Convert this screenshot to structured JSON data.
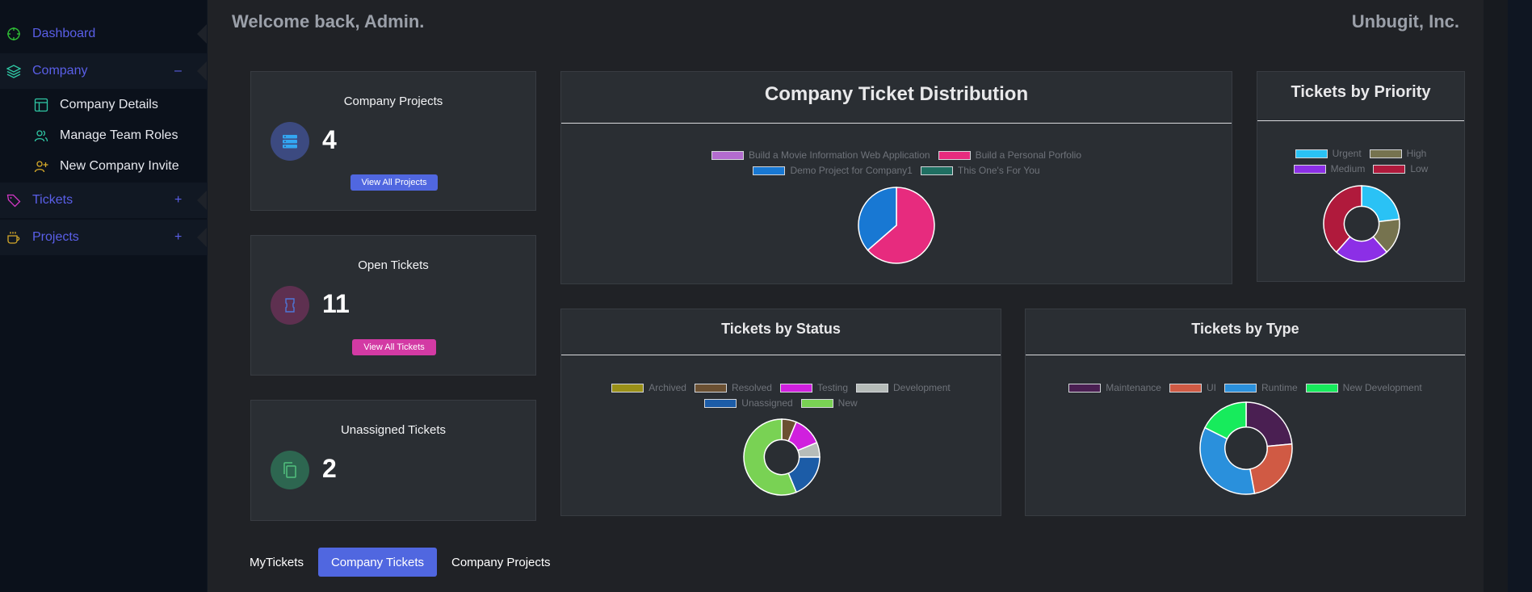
{
  "sidebar": {
    "items": [
      {
        "label": "Dashboard",
        "icon": "crosshair-icon",
        "color": "#5a5fe8",
        "icon_color": "#2fbe35"
      },
      {
        "label": "Company",
        "icon": "layers-icon",
        "color": "#5a5fe8",
        "icon_color": "#2fc7a4",
        "toggle": "–"
      },
      {
        "label": "Tickets",
        "icon": "tag-icon",
        "color": "#5a5fe8",
        "icon_color": "#d437c5",
        "toggle": "+"
      },
      {
        "label": "Projects",
        "icon": "coffee-icon",
        "color": "#5a5fe8",
        "icon_color": "#d5a92a",
        "toggle": "+"
      }
    ],
    "company_sub": [
      {
        "label": "Company Details",
        "icon": "layout-icon"
      },
      {
        "label": "Manage Team Roles",
        "icon": "users-icon"
      },
      {
        "label": "New Company Invite",
        "icon": "user-plus-icon"
      }
    ]
  },
  "header": {
    "welcome": "Welcome back, Admin.",
    "company": "Unbugit, Inc."
  },
  "stats": [
    {
      "title": "Company Projects",
      "value": "4",
      "button": "View All Projects",
      "icon": "server-icon",
      "icon_bg": "#3c4a80",
      "icon_color": "#33a6f2",
      "button_color": "#5067e0"
    },
    {
      "title": "Open Tickets",
      "value": "11",
      "button": "View All Tickets",
      "icon": "ticket-icon",
      "icon_bg": "#5e3050",
      "icon_color": "#4e77d8",
      "button_color": "#d33aa4"
    },
    {
      "title": "Unassigned Tickets",
      "value": "2",
      "button": "",
      "icon": "copy-icon",
      "icon_bg": "#2d6650",
      "icon_color": "#52c07e",
      "button_color": ""
    }
  ],
  "tabs": [
    {
      "label": "MyTickets",
      "active": false
    },
    {
      "label": "Company Tickets",
      "active": true
    },
    {
      "label": "Company Projects",
      "active": false
    }
  ],
  "chart_data": [
    {
      "type": "pie",
      "title": "Company Ticket Distribution",
      "categories": [
        "Build a Movie Information Web Application",
        "Build a Personal Porfolio",
        "Demo Project for Company1",
        "This One's For You"
      ],
      "values": [
        0,
        7,
        4,
        0
      ],
      "colors": [
        "#b36ccf",
        "#e72b7e",
        "#1878d3",
        "#1f6f62"
      ]
    },
    {
      "type": "doughnut",
      "title": "Tickets by Priority",
      "categories": [
        "Urgent",
        "High",
        "Medium",
        "Low"
      ],
      "values": [
        3,
        2,
        3,
        5
      ],
      "colors": [
        "#2ac2f5",
        "#76734f",
        "#8c2fe6",
        "#b01a3c"
      ]
    },
    {
      "type": "doughnut",
      "title": "Tickets by Status",
      "categories": [
        "Archived",
        "Resolved",
        "Testing",
        "Development",
        "Unassigned",
        "New"
      ],
      "values": [
        0,
        1,
        2,
        1,
        3,
        9
      ],
      "colors": [
        "#9a9018",
        "#6b5032",
        "#d020de",
        "#b6bcb9",
        "#1c5ca7",
        "#79d254"
      ]
    },
    {
      "type": "doughnut",
      "title": "Tickets by Type",
      "categories": [
        "Maintenance",
        "UI",
        "Runtime",
        "New Development"
      ],
      "values": [
        4,
        4,
        6,
        3
      ],
      "colors": [
        "#4a1f52",
        "#d05a44",
        "#2a90dc",
        "#17eb5c"
      ]
    }
  ]
}
